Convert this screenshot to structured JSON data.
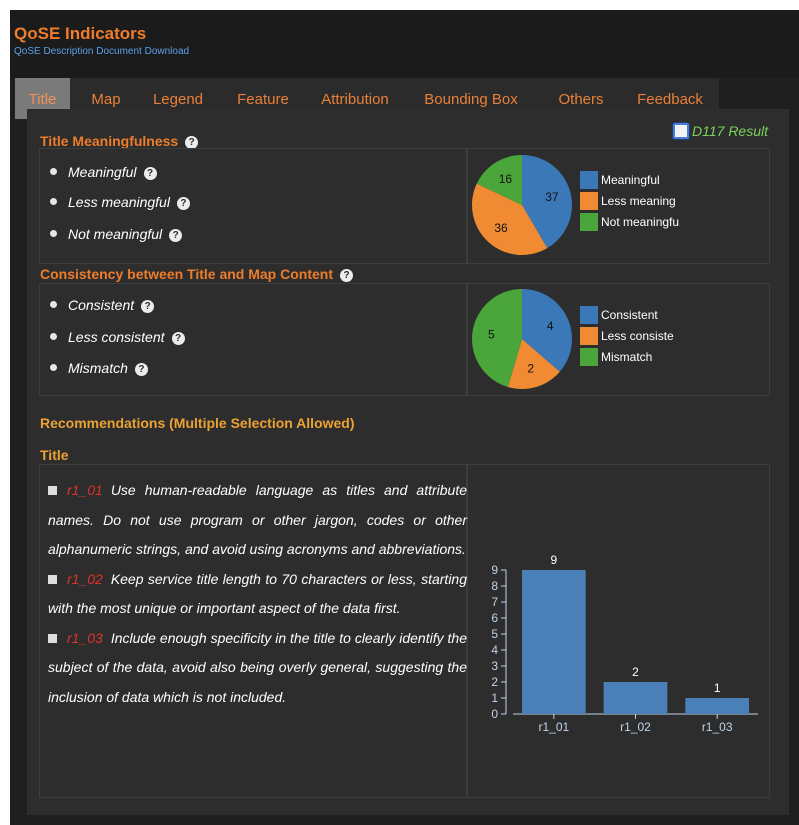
{
  "header": {
    "title": "QoSE Indicators",
    "description_link": "QoSE Description Document Download"
  },
  "tabs": [
    {
      "label": "Title",
      "active": true
    },
    {
      "label": "Map"
    },
    {
      "label": "Legend"
    },
    {
      "label": "Feature"
    },
    {
      "label": "Attribution"
    },
    {
      "label": "Bounding Box"
    },
    {
      "label": "Others"
    },
    {
      "label": "Feedback"
    }
  ],
  "result_toggle": {
    "label": "D117 Result",
    "checked": false
  },
  "title_meaningfulness": {
    "heading": "Title Meaningfulness",
    "help_icon": "question-circle-icon",
    "options": [
      "Meaningful",
      "Less meaningful",
      "Not meaningful"
    ],
    "legend": [
      "Meaningful",
      "Less meaning",
      "Not meaningfu"
    ]
  },
  "consistency": {
    "heading": "Consistency between Title and Map Content",
    "help_icon": "question-circle-icon",
    "options": [
      "Consistent",
      "Less consistent",
      "Mismatch"
    ],
    "legend": [
      "Consistent",
      "Less consiste",
      "Mismatch"
    ]
  },
  "recommendations": {
    "heading": "Recommendations (Multiple Selection Allowed)",
    "subheading": "Title",
    "items": [
      {
        "code": "r1_01",
        "text": "Use human-readable language as titles and attribute names. Do not use program or other jargon, codes or other alphanumeric strings, and avoid using acronyms and abbreviations."
      },
      {
        "code": "r1_02",
        "text": "Keep service title length to 70 characters or less, starting with the most unique or important aspect of the data first."
      },
      {
        "code": "r1_03",
        "text": "Include enough specificity in the title to clearly identify the subject of the data, avoid also being overly general, suggesting the inclusion of data which is not included."
      }
    ]
  },
  "colors": {
    "accent_orange": "#ee7d2b",
    "accent_gold": "#eba233",
    "result_green": "#7cd35a",
    "code_red": "#e0322b",
    "series_blue": "#3a78b8",
    "series_orange": "#f08a33",
    "series_green": "#4aa53a"
  },
  "chart_data": [
    {
      "type": "pie",
      "categories": [
        "Meaningful",
        "Less meaningful",
        "Not meaningful"
      ],
      "values": [
        37,
        36,
        16
      ],
      "colors": [
        "#3a78b8",
        "#f08a33",
        "#4aa53a"
      ],
      "legend_position": "right"
    },
    {
      "type": "pie",
      "categories": [
        "Consistent",
        "Less consistent",
        "Mismatch"
      ],
      "values": [
        4,
        2,
        5
      ],
      "colors": [
        "#3a78b8",
        "#f08a33",
        "#4aa53a"
      ],
      "legend_position": "right"
    },
    {
      "type": "bar",
      "categories": [
        "r1_01",
        "r1_02",
        "r1_03"
      ],
      "values": [
        9,
        2,
        1
      ],
      "ylim": [
        0,
        9
      ],
      "yticks": [
        0,
        1,
        2,
        3,
        4,
        5,
        6,
        7,
        8,
        9
      ],
      "color": "#4a7fb8",
      "grid": false
    }
  ]
}
